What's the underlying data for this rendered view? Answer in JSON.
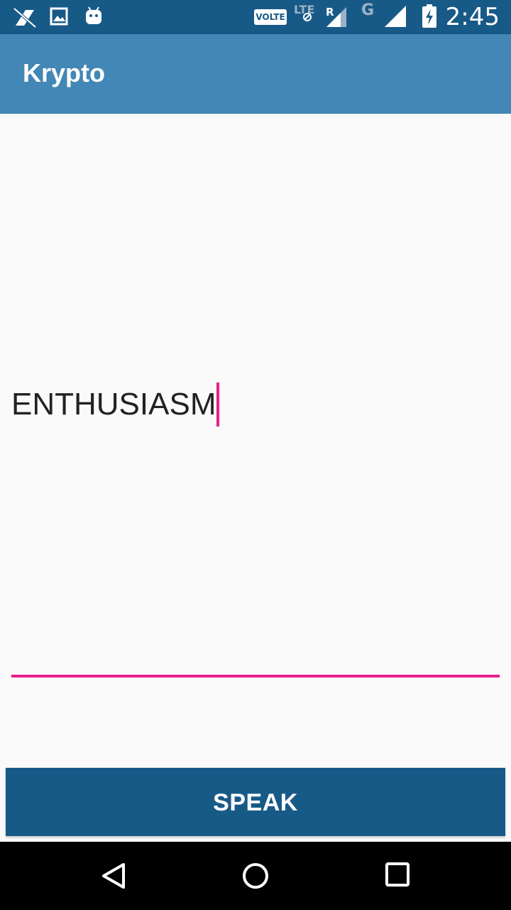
{
  "status_bar": {
    "time": "2:45",
    "volte_label": "VOLTE",
    "lte_label": "LTE",
    "roaming_label": "R",
    "network_label": "G",
    "icons": [
      "no-sim-sync-icon",
      "image-icon",
      "android-icon",
      "signal-icon",
      "battery-charging-icon"
    ]
  },
  "app_bar": {
    "title": "Krypto"
  },
  "main": {
    "input_value": "ENTHUSIASM",
    "speak_label": "SPEAK"
  },
  "nav_bar": {
    "icons": [
      "back-icon",
      "home-icon",
      "recents-icon"
    ]
  },
  "colors": {
    "status_bar": "#185a87",
    "app_bar": "#4287b5",
    "accent": "#e91e8c",
    "button": "#185a87"
  }
}
